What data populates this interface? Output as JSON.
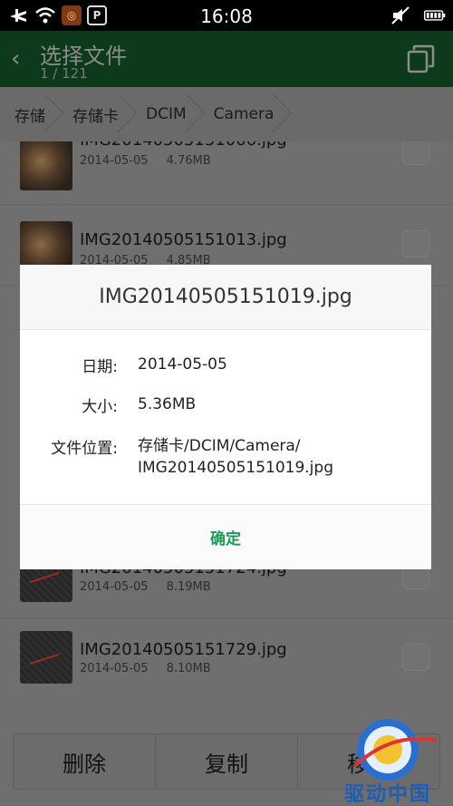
{
  "status_bar": {
    "time": "16:08",
    "icons": [
      "airplane-icon",
      "wifi-icon",
      "app-icon",
      "app-icon",
      "mute-icon",
      "battery-icon"
    ]
  },
  "header": {
    "title": "选择文件",
    "subtitle": "1 / 121",
    "back_icon": "back-arrow-icon",
    "copies_icon": "copies-icon"
  },
  "breadcrumb": {
    "items": [
      "存储",
      "存储卡",
      "DCIM",
      "Camera"
    ]
  },
  "files": [
    {
      "name": "IMG20140505151006.jpg",
      "date": "2014-05-05",
      "size": "4.76MB",
      "thumb": "cat"
    },
    {
      "name": "IMG20140505151013.jpg",
      "date": "2014-05-05",
      "size": "4.85MB",
      "thumb": "cat"
    },
    {
      "name": "IMG20140505151724.jpg",
      "date": "2014-05-05",
      "size": "8.19MB",
      "thumb": "dark"
    },
    {
      "name": "IMG20140505151729.jpg",
      "date": "2014-05-05",
      "size": "8.10MB",
      "thumb": "dark"
    }
  ],
  "bottom_bar": {
    "delete": "删除",
    "copy": "复制",
    "move": "移动"
  },
  "dialog": {
    "title": "IMG20140505151019.jpg",
    "date_label": "日期:",
    "date_value": "2014-05-05",
    "size_label": "大小:",
    "size_value": "5.36MB",
    "location_label": "文件位置:",
    "location_value": "存储卡/DCIM/Camera/",
    "location_value_2": "IMG20140505151019.jpg",
    "ok": "确定"
  },
  "watermark": {
    "text": "驱动中国"
  },
  "colors": {
    "accent": "#1a9a53",
    "titlebar": "#0d3a1a"
  }
}
